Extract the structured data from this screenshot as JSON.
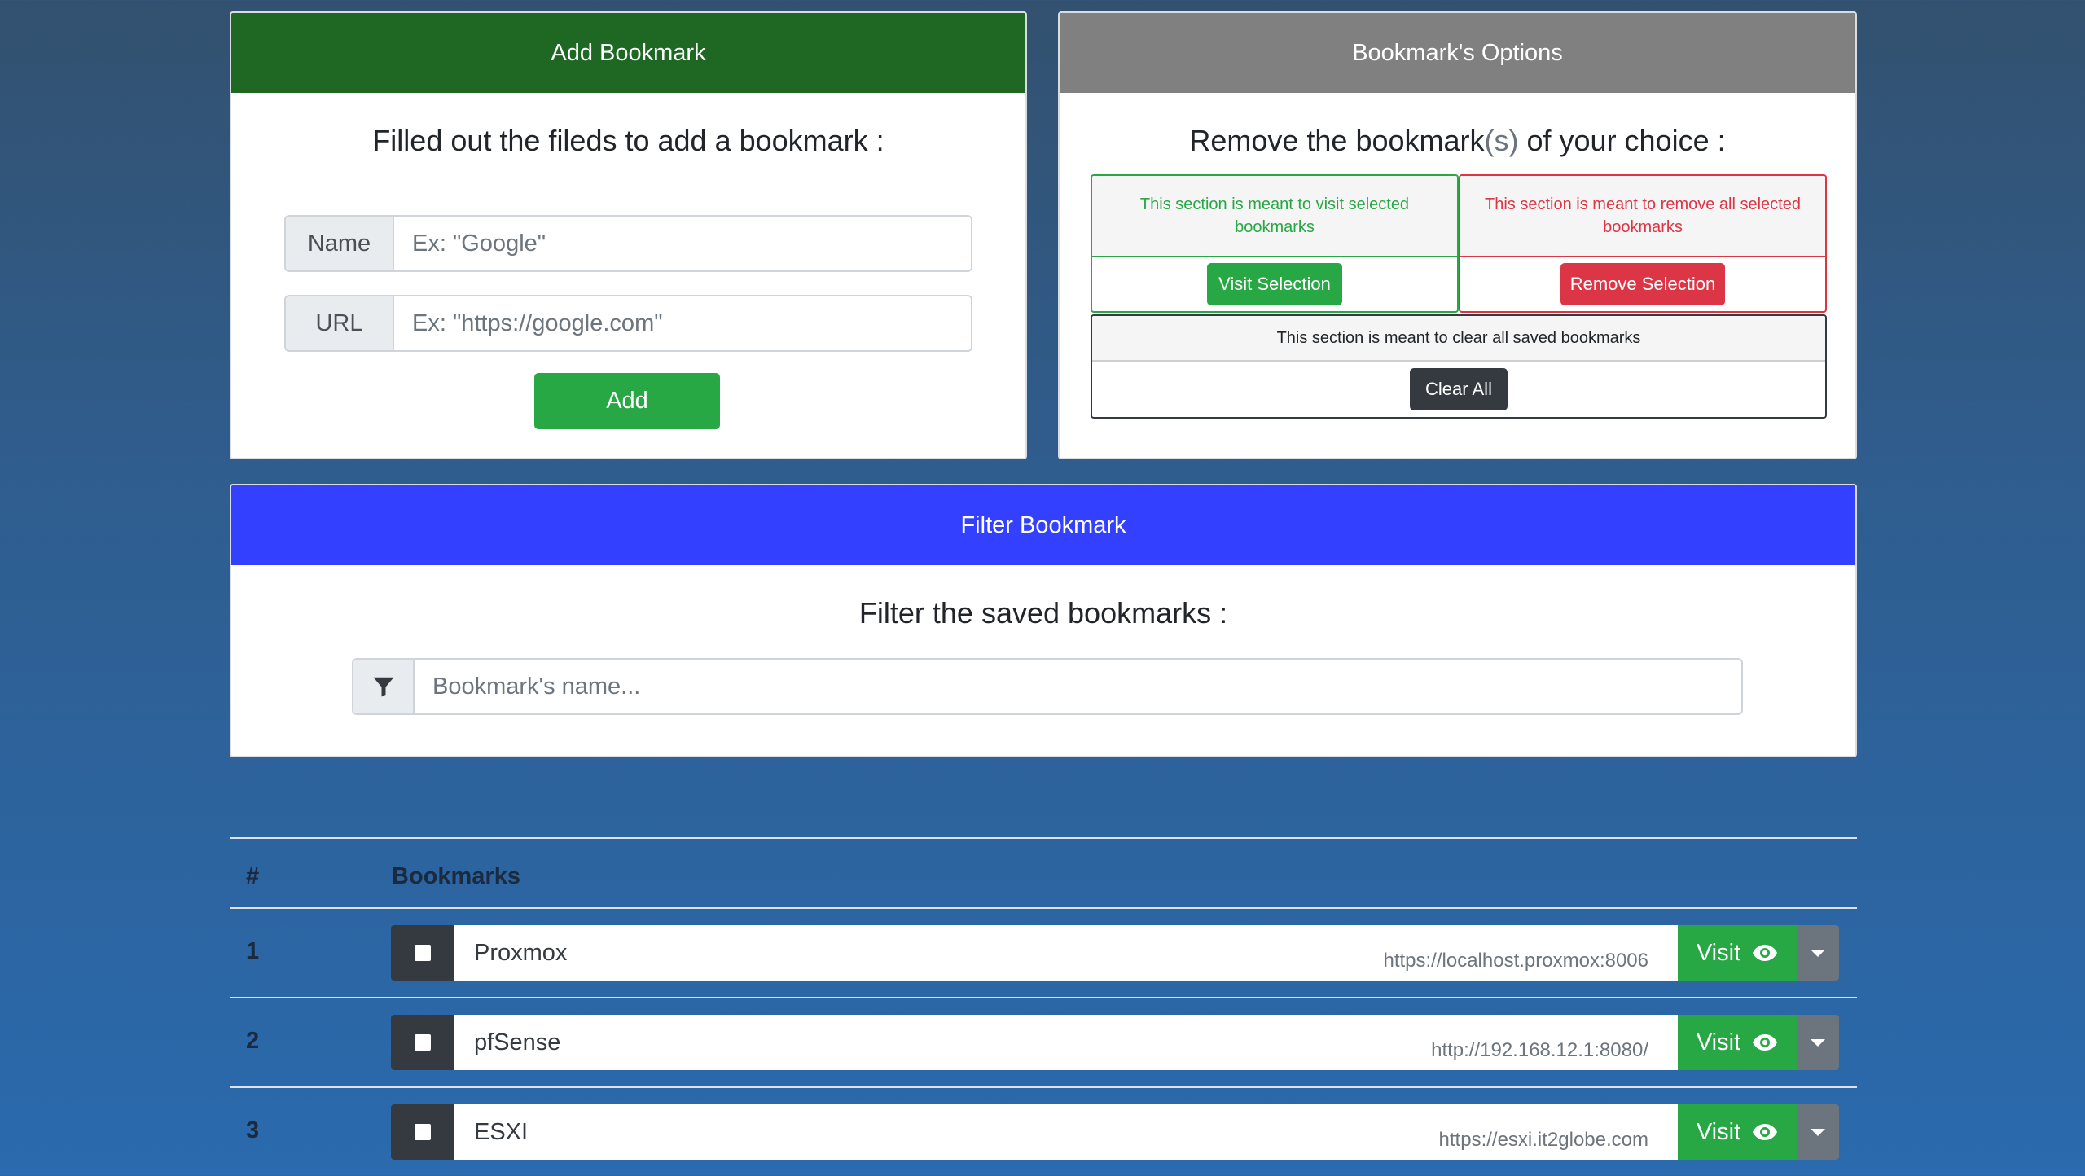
{
  "add_card": {
    "header": "Add Bookmark",
    "title": "Filled out the fileds to add a bookmark :",
    "name_label": "Name",
    "name_placeholder": "Ex: \"Google\"",
    "url_label": "URL",
    "url_placeholder": "Ex: \"https://google.com\"",
    "add_label": "Add"
  },
  "options_card": {
    "header": "Bookmark's Options",
    "title_pre": "Remove the bookmark",
    "title_muted": "(s)",
    "title_post": " of your choice :",
    "visit_text": "This section is meant to visit selected bookmarks",
    "visit_button": "Visit Selection",
    "remove_text": "This section is meant to remove all selected bookmarks",
    "remove_button": "Remove Selection",
    "clear_text": "This section is meant to clear all saved bookmarks",
    "clear_button": "Clear All"
  },
  "filter_card": {
    "header": "Filter Bookmark",
    "title": "Filter the saved bookmarks :",
    "placeholder": "Bookmark's name...",
    "icon": "filter-icon"
  },
  "table": {
    "col_num": "#",
    "col_bookmarks": "Bookmarks",
    "rows": [
      {
        "num": "1",
        "name": "Proxmox",
        "url": "https://localhost.proxmox:8006",
        "visit": "Visit"
      },
      {
        "num": "2",
        "name": "pfSense",
        "url": "http://192.168.12.1:8080/",
        "visit": "Visit"
      },
      {
        "num": "3",
        "name": "ESXI",
        "url": "https://esxi.it2globe.com",
        "visit": "Visit"
      }
    ]
  },
  "colors": {
    "add_header": "#1e6823",
    "options_header": "#808080",
    "filter_header": "#3340ff",
    "success": "#28a745",
    "danger": "#dc3545",
    "dark": "#343a40"
  }
}
